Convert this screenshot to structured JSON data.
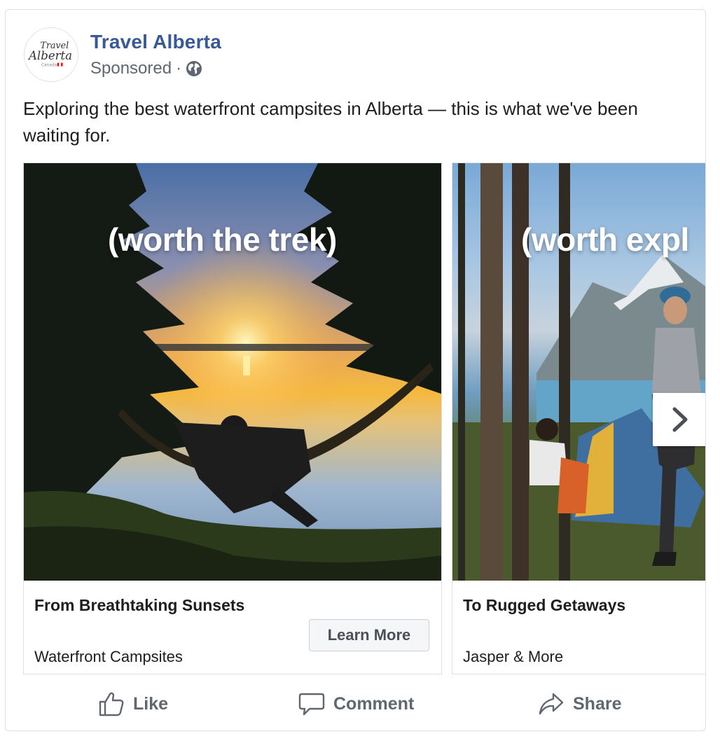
{
  "post": {
    "page_name": "Travel Alberta",
    "sponsored_label": "Sponsored",
    "separator": "·",
    "avatar": {
      "logo_text_line1": "Travel",
      "logo_text_line2": "Alberta",
      "logo_text_line3": "Canada",
      "icon": "travel-alberta-logo"
    },
    "privacy_icon": "globe-icon",
    "message": "Exploring the best waterfront campsites in Alberta — this is what we've been waiting for."
  },
  "carousel": {
    "cards": [
      {
        "overlay_text": "(worth the trek)",
        "title": "From Breathtaking Sunsets",
        "subtitle": "Waterfront Campsites",
        "cta_label": "Learn More"
      },
      {
        "overlay_text": "(worth expl",
        "title": "To Rugged Getaways",
        "subtitle": "Jasper & More"
      }
    ],
    "next_icon": "chevron-right-icon"
  },
  "actions": {
    "like": "Like",
    "comment": "Comment",
    "share": "Share"
  },
  "colors": {
    "link_blue": "#385898",
    "meta_gray": "#606770",
    "text": "#1c1e21",
    "border": "#dddfe2"
  }
}
